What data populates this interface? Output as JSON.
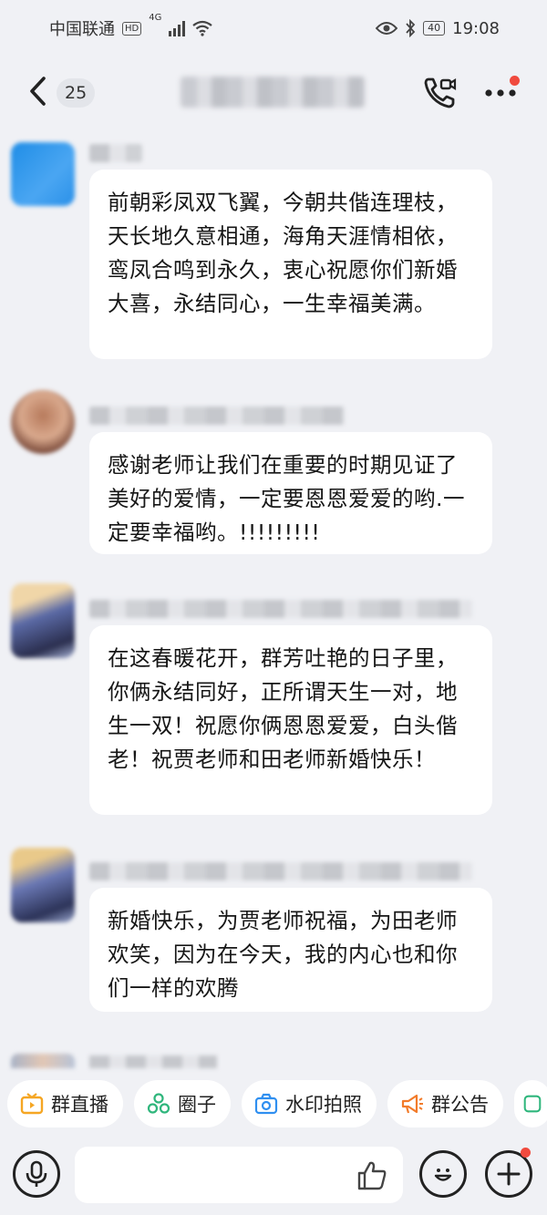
{
  "status_bar": {
    "carrier": "中国联通",
    "hd_badge": "HD",
    "network": "4G",
    "battery": "40",
    "time": "19:08"
  },
  "header": {
    "back_count": "25",
    "group_title": ""
  },
  "messages": [
    {
      "text": "前朝彩凤双飞翼，今朝共偕连理枝，天长地久意相通，海角天涯情相依，鸾凤合鸣到永久，衷心祝愿你们新婚大喜，永结同心，一生幸福美满。"
    },
    {
      "text": "感谢老师让我们在重要的时期见证了美好的爱情，一定要恩恩爱爱的哟.一定要幸福哟。!!!!!!!!!"
    },
    {
      "text": "在这春暖花开，群芳吐艳的日子里，你俩永结同好，正所谓天生一对，地生一双！祝愿你俩恩恩爱爱，白头偕老！祝贾老师和田老师新婚快乐！"
    },
    {
      "text": "新婚快乐，为贾老师祝福，为田老师欢笑，因为在今天，我的内心也和你们一样的欢腾"
    }
  ],
  "quick_actions": [
    {
      "label": "群直播",
      "icon": "tv-icon",
      "color": "#f5a623"
    },
    {
      "label": "圈子",
      "icon": "circles-icon",
      "color": "#2fb67c"
    },
    {
      "label": "水印拍照",
      "icon": "camera-icon",
      "color": "#2f8ff0"
    },
    {
      "label": "群公告",
      "icon": "megaphone-icon",
      "color": "#f27b2a"
    }
  ],
  "input": {
    "placeholder": ""
  },
  "colors": {
    "background": "#f0f1f5",
    "bubble": "#ffffff",
    "notification_dot": "#f04a3e"
  }
}
